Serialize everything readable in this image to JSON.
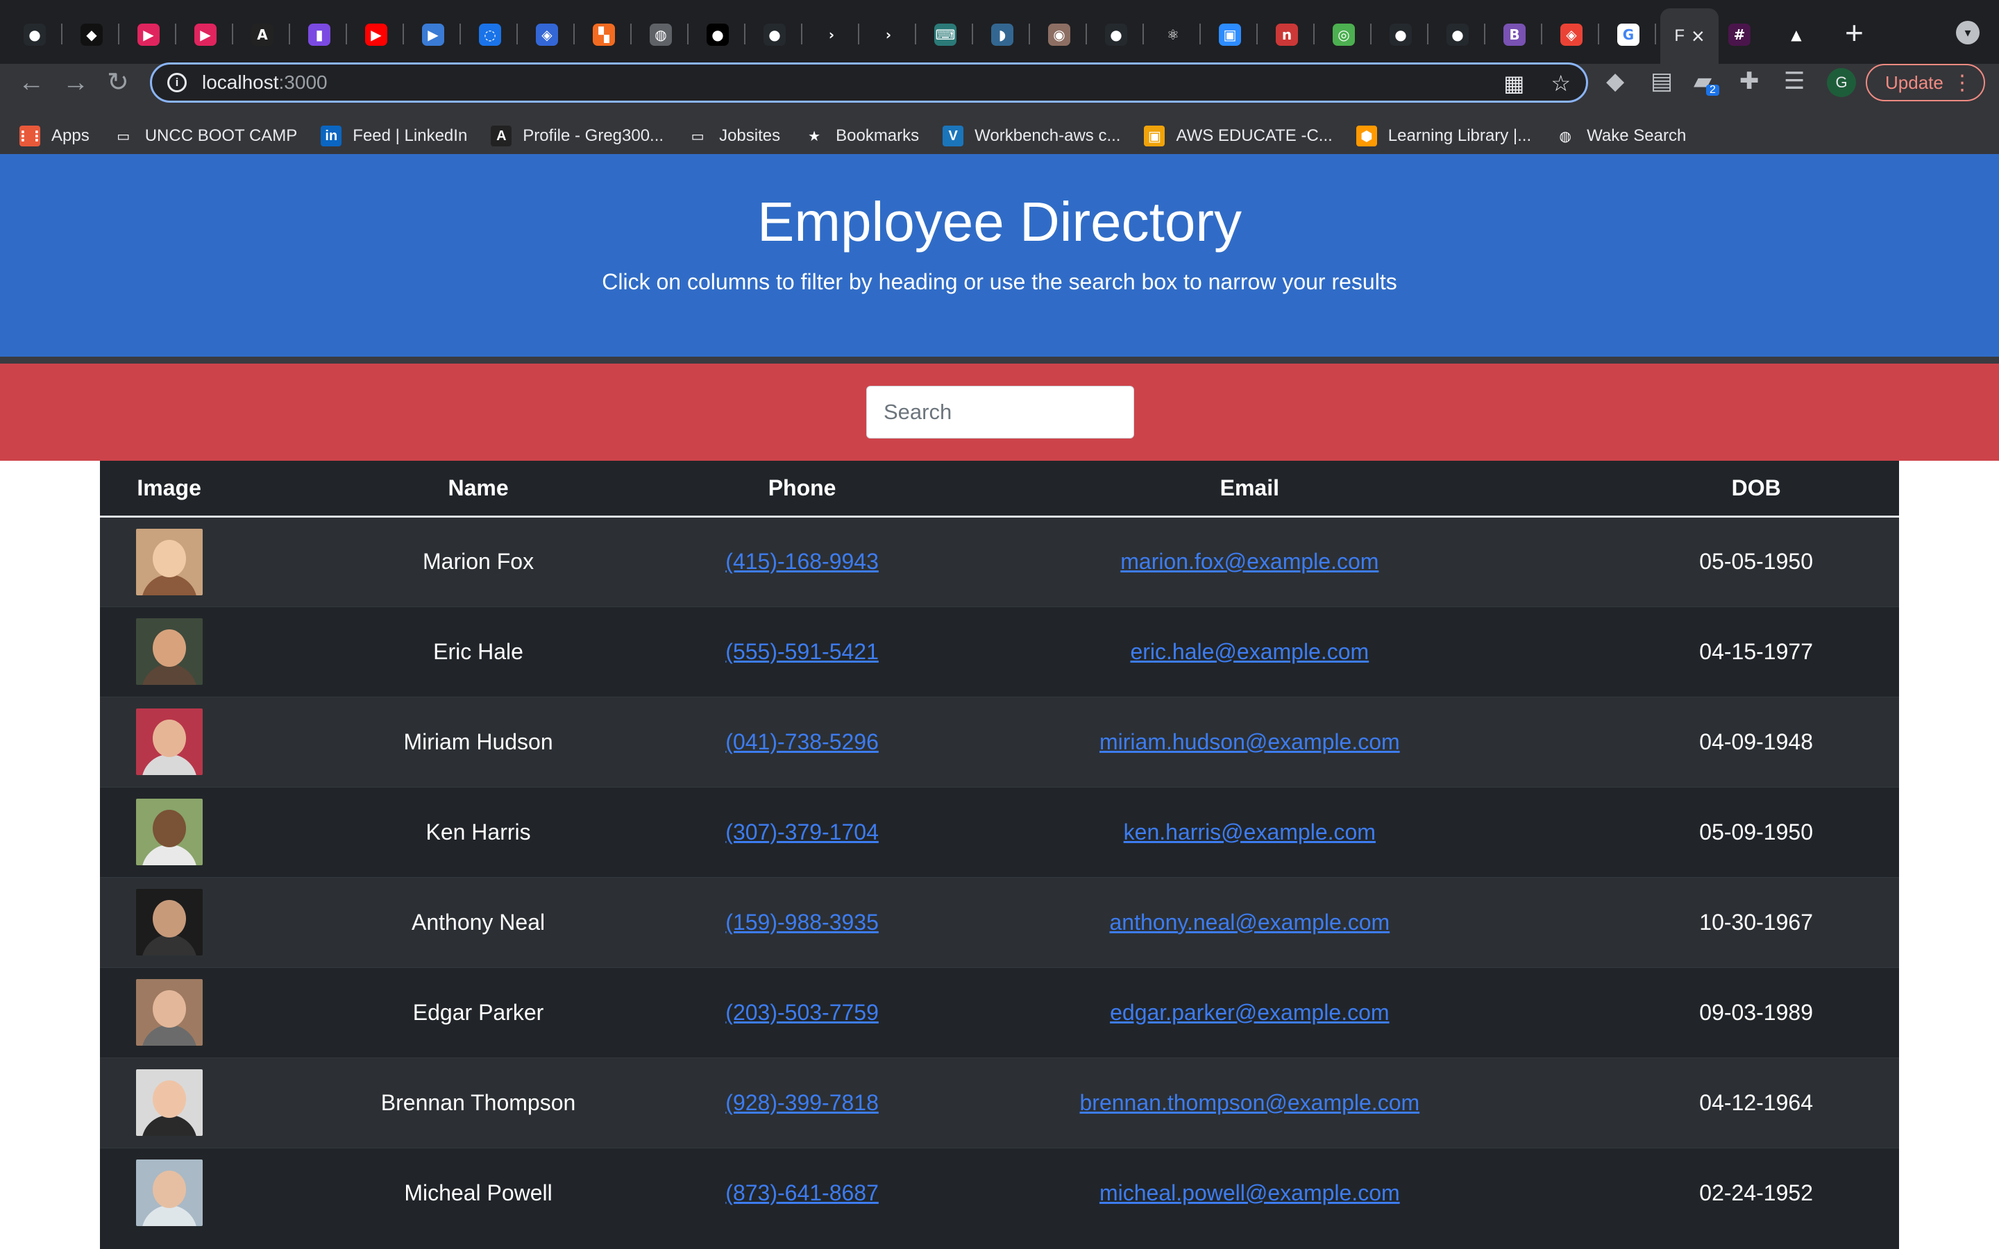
{
  "browser": {
    "active_tab_label": "F",
    "new_tab_label": "+",
    "tab_favicons": [
      {
        "name": "github-favicon",
        "glyph": "●",
        "bg": "#24292e"
      },
      {
        "name": "app-favicon-2",
        "glyph": "◆",
        "bg": "#111111"
      },
      {
        "name": "video-favicon-1",
        "glyph": "▶",
        "bg": "#e0245e"
      },
      {
        "name": "video-favicon-2",
        "glyph": "▶",
        "bg": "#e0245e"
      },
      {
        "name": "code-favicon",
        "glyph": "A",
        "bg": "#222222"
      },
      {
        "name": "doc-favicon",
        "glyph": "▮",
        "bg": "#7b4ae2"
      },
      {
        "name": "youtube-favicon",
        "glyph": "▶",
        "bg": "#ff0000"
      },
      {
        "name": "media-favicon",
        "glyph": "▶",
        "bg": "#3a7bd5"
      },
      {
        "name": "loader-favicon",
        "glyph": "◌",
        "bg": "#1a73e8"
      },
      {
        "name": "cube-favicon",
        "glyph": "◈",
        "bg": "#3367d6"
      },
      {
        "name": "orange-favicon",
        "glyph": "▚",
        "bg": "#f26b21"
      },
      {
        "name": "globe-favicon",
        "glyph": "◍",
        "bg": "#5f6368"
      },
      {
        "name": "medium-favicon",
        "glyph": "●",
        "bg": "#000000"
      },
      {
        "name": "github-favicon-2",
        "glyph": "●",
        "bg": "#24292e"
      },
      {
        "name": "red-arrow-favicon",
        "glyph": "›",
        "bg": "#1f2023"
      },
      {
        "name": "red-arrow-favicon-2",
        "glyph": "›",
        "bg": "#1f2023"
      },
      {
        "name": "keyboard-favicon",
        "glyph": "⌨",
        "bg": "#2b7a78"
      },
      {
        "name": "elephant-favicon",
        "glyph": "◗",
        "bg": "#336791"
      },
      {
        "name": "owl-favicon",
        "glyph": "◉",
        "bg": "#8d6e63"
      },
      {
        "name": "github-favicon-3",
        "glyph": "●",
        "bg": "#24292e"
      },
      {
        "name": "react-favicon",
        "glyph": "⚛",
        "bg": "#1f2023"
      },
      {
        "name": "zoom-favicon",
        "glyph": "▣",
        "bg": "#2d8cff"
      },
      {
        "name": "npm-favicon",
        "glyph": "n",
        "bg": "#cb3837"
      },
      {
        "name": "green-favicon",
        "glyph": "◎",
        "bg": "#4caf50"
      },
      {
        "name": "github-favicon-4",
        "glyph": "●",
        "bg": "#24292e"
      },
      {
        "name": "github-favicon-5",
        "glyph": "●",
        "bg": "#24292e"
      },
      {
        "name": "bootstrap-favicon",
        "glyph": "B",
        "bg": "#7952b3"
      },
      {
        "name": "maps-favicon",
        "glyph": "◈",
        "bg": "#ea4335"
      },
      {
        "name": "google-favicon",
        "glyph": "G",
        "bg": "#ffffff"
      }
    ],
    "trailing_favicons": [
      {
        "name": "slack-favicon",
        "glyph": "#",
        "bg": "#4a154b"
      },
      {
        "name": "drive-favicon",
        "glyph": "▲",
        "bg": "#1f2023"
      }
    ],
    "url_host": "localhost",
    "url_port": ":3000",
    "update_label": "Update",
    "profile_initial": "G",
    "extension_badge": "2",
    "bookmarks": [
      {
        "label": "Apps",
        "icon": "apps-grid-icon",
        "glyph": "⋮⋮",
        "color": "#e8593a"
      },
      {
        "label": "UNCC BOOT CAMP",
        "icon": "folder-icon",
        "glyph": "▭",
        "color": "#35363a"
      },
      {
        "label": "Feed | LinkedIn",
        "icon": "linkedin-icon",
        "glyph": "in",
        "color": "#0a66c2"
      },
      {
        "label": "Profile - Greg300...",
        "icon": "code-icon",
        "glyph": "A",
        "color": "#222222"
      },
      {
        "label": "Jobsites",
        "icon": "folder-icon",
        "glyph": "▭",
        "color": "#35363a"
      },
      {
        "label": "Bookmarks",
        "icon": "star-icon",
        "glyph": "★",
        "color": "#35363a"
      },
      {
        "label": "Workbench-aws c...",
        "icon": "vocareum-icon",
        "glyph": "V",
        "color": "#1b75bb"
      },
      {
        "label": "AWS EDUCATE -C...",
        "icon": "aws-box-icon",
        "glyph": "▣",
        "color": "#f0a30a"
      },
      {
        "label": "Learning Library |...",
        "icon": "hexagon-icon",
        "glyph": "⬢",
        "color": "#ff9900"
      },
      {
        "label": "Wake Search",
        "icon": "globe-icon",
        "glyph": "◍",
        "color": "#35363a"
      }
    ]
  },
  "page": {
    "title": "Employee Directory",
    "subtitle": "Click on columns to filter by heading or use the search box to narrow your results",
    "search_placeholder": "Search",
    "columns": [
      "Image",
      "Name",
      "Phone",
      "Email",
      "DOB"
    ],
    "employees": [
      {
        "name": "Marion Fox",
        "phone": "(415)-168-9943",
        "email": "marion.fox@example.com",
        "dob": "05-05-1950",
        "avatar_bg": "#c9a27e",
        "avatar_skin": "#f0c9a6",
        "avatar_shirt": "#8c5a3c"
      },
      {
        "name": "Eric Hale",
        "phone": "(555)-591-5421",
        "email": "eric.hale@example.com",
        "dob": "04-15-1977",
        "avatar_bg": "#3e4a3c",
        "avatar_skin": "#d8a27c",
        "avatar_shirt": "#5b4637"
      },
      {
        "name": "Miriam Hudson",
        "phone": "(041)-738-5296",
        "email": "miriam.hudson@example.com",
        "dob": "04-09-1948",
        "avatar_bg": "#b8364a",
        "avatar_skin": "#e6b596",
        "avatar_shirt": "#d9d9d9"
      },
      {
        "name": "Ken Harris",
        "phone": "(307)-379-1704",
        "email": "ken.harris@example.com",
        "dob": "05-09-1950",
        "avatar_bg": "#8aa46a",
        "avatar_skin": "#7a5236",
        "avatar_shirt": "#e9e9e9"
      },
      {
        "name": "Anthony Neal",
        "phone": "(159)-988-3935",
        "email": "anthony.neal@example.com",
        "dob": "10-30-1967",
        "avatar_bg": "#1c1c1c",
        "avatar_skin": "#c79a7a",
        "avatar_shirt": "#333333"
      },
      {
        "name": "Edgar Parker",
        "phone": "(203)-503-7759",
        "email": "edgar.parker@example.com",
        "dob": "09-03-1989",
        "avatar_bg": "#9e7a62",
        "avatar_skin": "#e3b79a",
        "avatar_shirt": "#6b6b6b"
      },
      {
        "name": "Brennan Thompson",
        "phone": "(928)-399-7818",
        "email": "brennan.thompson@example.com",
        "dob": "04-12-1964",
        "avatar_bg": "#d9d9d9",
        "avatar_skin": "#efc4a6",
        "avatar_shirt": "#2a2a2a"
      },
      {
        "name": "Micheal Powell",
        "phone": "(873)-641-8687",
        "email": "micheal.powell@example.com",
        "dob": "02-24-1952",
        "avatar_bg": "#a9b9c6",
        "avatar_skin": "#e6bfa2",
        "avatar_shirt": "#dfe6ea"
      }
    ]
  },
  "colors": {
    "hero": "#306cc7",
    "search_band": "#cd434a",
    "table_bg": "#212529",
    "table_stripe": "#2c3034",
    "link": "#3d7cf1"
  }
}
